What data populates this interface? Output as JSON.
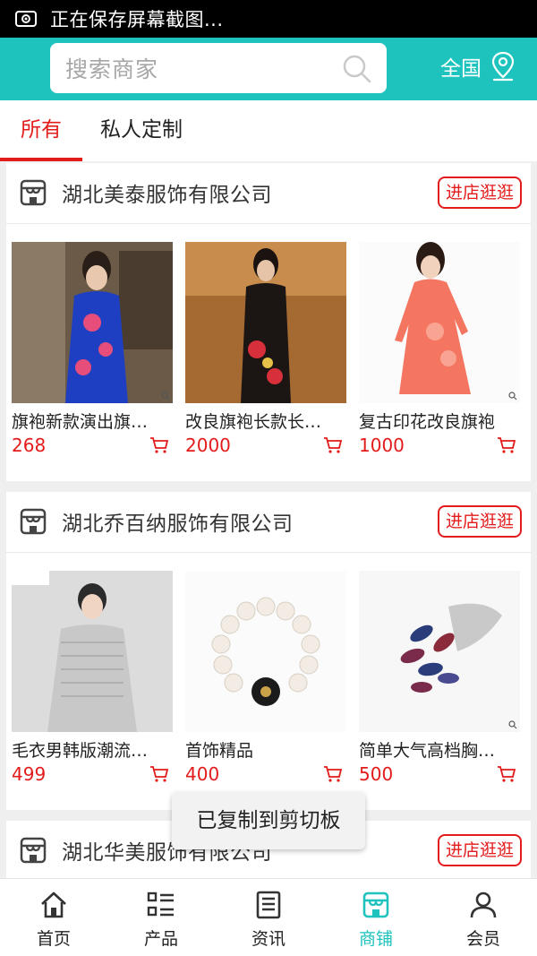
{
  "status_bar": {
    "text": "正在保存屏幕截图..."
  },
  "header": {
    "search_placeholder": "搜索商家",
    "region": "全国"
  },
  "tabs": [
    {
      "label": "所有",
      "active": true
    },
    {
      "label": "私人定制",
      "active": false
    }
  ],
  "shops": [
    {
      "name": "湖北美泰服饰有限公司",
      "visit_label": "进店逛逛",
      "products": [
        {
          "title": "旗袍新款演出旗…",
          "price": "268"
        },
        {
          "title": "改良旗袍长款长…",
          "price": "2000"
        },
        {
          "title": "复古印花改良旗袍",
          "price": "1000"
        }
      ]
    },
    {
      "name": "湖北乔百纳服饰有限公司",
      "visit_label": "进店逛逛",
      "products": [
        {
          "title": "毛衣男韩版潮流…",
          "price": "499"
        },
        {
          "title": "首饰精品",
          "price": "400"
        },
        {
          "title": "简单大气高档胸…",
          "price": "500"
        }
      ]
    },
    {
      "name": "湖北华美服饰有限公司",
      "visit_label": "进店逛逛",
      "products": []
    }
  ],
  "toast": "已复制到剪切板",
  "bottom_nav": [
    {
      "label": "首页",
      "icon": "home-icon"
    },
    {
      "label": "产品",
      "icon": "grid-list-icon"
    },
    {
      "label": "资讯",
      "icon": "news-icon"
    },
    {
      "label": "商铺",
      "icon": "store-icon",
      "active": true
    },
    {
      "label": "会员",
      "icon": "user-icon"
    }
  ],
  "colors": {
    "accent": "#1ec3bd",
    "price": "#e31b1b",
    "status_bar": "#000000"
  }
}
